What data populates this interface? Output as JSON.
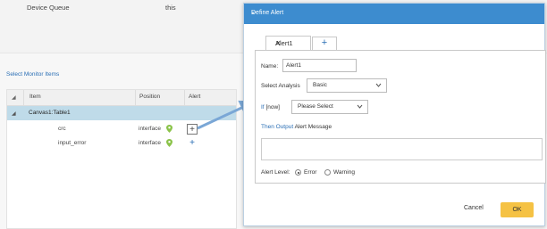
{
  "background": {
    "device_queue_label": "Device Queue",
    "device_queue_value": "this",
    "section_title": "Select Monitor Items",
    "columns": [
      "Item",
      "Position",
      "Alert"
    ],
    "group": {
      "label": "Canvas1:Table1"
    },
    "rows": [
      {
        "item": "crc",
        "position": "interface",
        "alert": "+"
      },
      {
        "item": "input_error",
        "position": "interface",
        "alert": "+"
      }
    ]
  },
  "dialog": {
    "title": "Define Alert",
    "tabs": [
      {
        "label": "Alert1"
      }
    ],
    "add_tab_label": "+",
    "name_label": "Name:",
    "name_value": "Alert1",
    "select_analysis_label": "Select Analysis",
    "analysis_value": "Basic",
    "if_label": "If",
    "if_scope": "[now]",
    "if_placeholder": "Please Select",
    "then_output_label": "Then Output",
    "alert_message_label": "Alert Message",
    "alert_level_label": "Alert Level:",
    "levels": [
      {
        "label": "Error",
        "selected": true
      },
      {
        "label": "Warning",
        "selected": false
      }
    ],
    "cancel_label": "Cancel",
    "ok_label": "OK"
  },
  "colors": {
    "title_bar": "#3d8ccf",
    "link": "#2b6fb5",
    "group_row": "#bfdbe9",
    "ok_button": "#f5c244",
    "pin": "#8bc34a"
  }
}
